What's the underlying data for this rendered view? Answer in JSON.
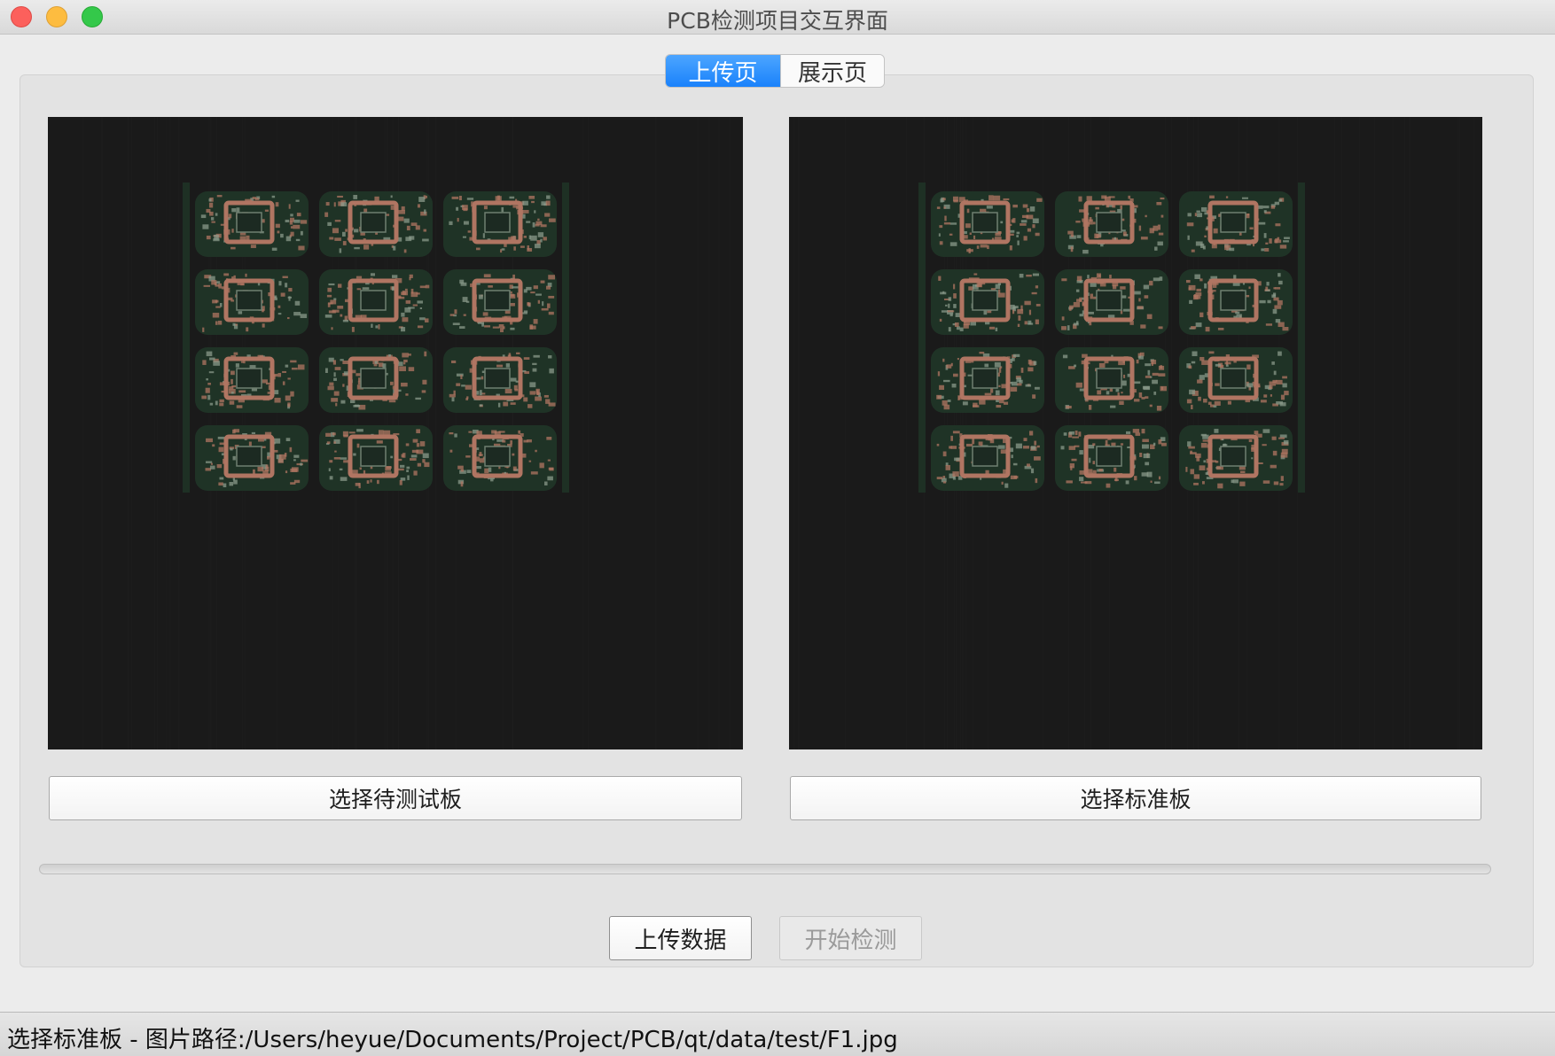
{
  "window": {
    "title": "PCB检测项目交互界面"
  },
  "tabs": [
    {
      "label": "上传页",
      "active": true
    },
    {
      "label": "展示页",
      "active": false
    }
  ],
  "panels": {
    "left_button_label": "选择待测试板",
    "right_button_label": "选择标准板"
  },
  "progress": {
    "value": 0
  },
  "actions": {
    "upload_label": "上传数据",
    "start_label": "开始检测",
    "start_enabled": false
  },
  "status": {
    "text": "选择标准板 - 图片路径:/Users/heyue/Documents/Project/PCB/qt/data/test/F1.jpg"
  },
  "colors": {
    "accent": "#1a82fb",
    "image_background": "#1a1a1a",
    "pcb_green": "#1f3326",
    "pcb_copper": "#b07562"
  }
}
